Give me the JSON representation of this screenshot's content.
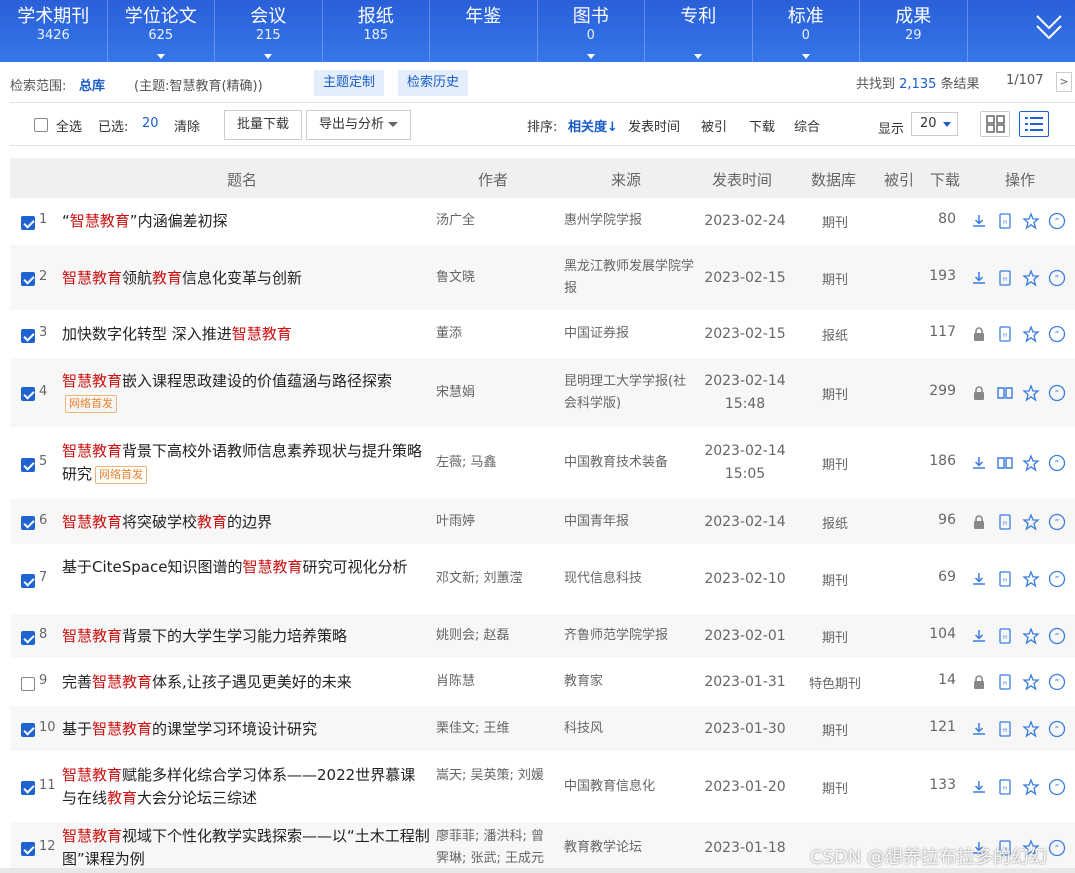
{
  "tabs": [
    {
      "label": "学术期刊",
      "count": "3426",
      "arrow": false
    },
    {
      "label": "学位论文",
      "count": "625",
      "arrow": true
    },
    {
      "label": "会议",
      "count": "215",
      "arrow": true
    },
    {
      "label": "报纸",
      "count": "185",
      "arrow": false
    },
    {
      "label": "年鉴",
      "count": "",
      "arrow": false
    },
    {
      "label": "图书",
      "count": "0",
      "arrow": true
    },
    {
      "label": "专利",
      "count": "",
      "arrow": true
    },
    {
      "label": "标准",
      "count": "0",
      "arrow": true
    },
    {
      "label": "成果",
      "count": "29",
      "arrow": false
    }
  ],
  "scope": {
    "label": "检索范围:",
    "library": "总库",
    "topic": "(主题:智慧教育(精确))",
    "btn_custom": "主题定制",
    "btn_history": "检索历史",
    "found_prefix": "共找到",
    "found_count": "2,135",
    "found_suffix": "条结果",
    "page": "1/107",
    "next": ">"
  },
  "toolbar": {
    "select_all": "全选",
    "selected_label": "已选:",
    "selected_count": "20",
    "clear": "清除",
    "batch_download": "批量下载",
    "export": "导出与分析",
    "sort_label": "排序:",
    "sort_relevance": "相关度",
    "sort_date": "发表时间",
    "sort_cited": "被引",
    "sort_download": "下载",
    "sort_combined": "综合",
    "show_label": "显示",
    "show_value": "20"
  },
  "columns": {
    "title": "题名",
    "author": "作者",
    "source": "来源",
    "date": "发表时间",
    "db": "数据库",
    "cited": "被引",
    "download": "下载",
    "ops": "操作"
  },
  "rows": [
    {
      "no": "1",
      "checked": true,
      "title": [
        "“",
        "智慧教育",
        "”内涵偏差初探"
      ],
      "badge": "",
      "author": "汤广全",
      "source": "惠州学院学报",
      "date": "2023-02-24",
      "time": "",
      "db": "期刊",
      "download": "80",
      "locked": false,
      "read": false
    },
    {
      "no": "2",
      "checked": true,
      "title": [
        "",
        "智慧教育",
        "领航",
        "教育",
        "信息化变革与创新"
      ],
      "badge": "",
      "author": "鲁文晓",
      "source": "黑龙江教师发展学院学报",
      "date": "2023-02-15",
      "time": "",
      "db": "期刊",
      "download": "193",
      "locked": false,
      "read": false
    },
    {
      "no": "3",
      "checked": true,
      "title": [
        "加快数字化转型 深入推进",
        "智慧教育",
        ""
      ],
      "badge": "",
      "author": "董添",
      "source": "中国证券报",
      "date": "2023-02-15",
      "time": "",
      "db": "报纸",
      "download": "117",
      "locked": true,
      "read": false
    },
    {
      "no": "4",
      "checked": true,
      "title": [
        "",
        "智慧教育",
        "嵌入课程思政建设的价值蕴涵与路径探索"
      ],
      "badge": "网络首发",
      "author": "宋慧娟",
      "source": "昆明理工大学学报(社会科学版)",
      "date": "2023-02-14",
      "time": "15:48",
      "db": "期刊",
      "download": "299",
      "locked": true,
      "read": true
    },
    {
      "no": "5",
      "checked": true,
      "title": [
        "",
        "智慧教育",
        "背景下高校外语教师信息素养现状与提升策略研究"
      ],
      "badge": "网络首发",
      "author": "左薇; 马鑫",
      "source": "中国教育技术装备",
      "date": "2023-02-14",
      "time": "15:05",
      "db": "期刊",
      "download": "186",
      "locked": false,
      "read": true
    },
    {
      "no": "6",
      "checked": true,
      "title": [
        "",
        "智慧教育",
        "将突破学校",
        "教育",
        "的边界"
      ],
      "badge": "",
      "author": "叶雨婷",
      "source": "中国青年报",
      "date": "2023-02-14",
      "time": "",
      "db": "报纸",
      "download": "96",
      "locked": true,
      "read": false
    },
    {
      "no": "7",
      "checked": true,
      "title": [
        "基于CiteSpace知识图谱的",
        "智慧教育",
        "研究可视化分析"
      ],
      "badge": "",
      "author": "邓文新; 刘蕙滢",
      "source": "现代信息科技",
      "date": "2023-02-10",
      "time": "",
      "db": "期刊",
      "download": "69",
      "locked": false,
      "read": false
    },
    {
      "no": "8",
      "checked": true,
      "title": [
        "",
        "智慧教育",
        "背景下的大学生学习能力培养策略"
      ],
      "badge": "",
      "author": "姚则会; 赵磊",
      "source": "齐鲁师范学院学报",
      "date": "2023-02-01",
      "time": "",
      "db": "期刊",
      "download": "104",
      "locked": false,
      "read": false
    },
    {
      "no": "9",
      "checked": false,
      "title": [
        "完善",
        "智慧教育",
        "体系,让孩子遇见更美好的未来"
      ],
      "badge": "",
      "author": "肖陈慧",
      "source": "教育家",
      "date": "2023-01-31",
      "time": "",
      "db": "特色期刊",
      "download": "14",
      "locked": true,
      "read": false
    },
    {
      "no": "10",
      "checked": true,
      "title": [
        "基于",
        "智慧教育",
        "的课堂学习环境设计研究"
      ],
      "badge": "",
      "author": "栗佳文; 王维",
      "source": "科技风",
      "date": "2023-01-30",
      "time": "",
      "db": "期刊",
      "download": "121",
      "locked": false,
      "read": false
    },
    {
      "no": "11",
      "checked": true,
      "title": [
        "",
        "智慧教育",
        "赋能多样化综合学习体系——2022世界慕课与在线",
        "教育",
        "大会分论坛三综述"
      ],
      "badge": "",
      "author": "嵩天; 吴英策; 刘媛",
      "source": "中国教育信息化",
      "date": "2023-01-20",
      "time": "",
      "db": "期刊",
      "download": "133",
      "locked": false,
      "read": false
    },
    {
      "no": "12",
      "checked": true,
      "title": [
        "",
        "智慧教育",
        "视域下个性化教学实践探索——以“土木工程制图”课程为例"
      ],
      "badge": "",
      "author": "廖菲菲; 潘洪科; 曾霁琳; 张武; 王成元",
      "source": "教育教学论坛",
      "date": "2023-01-18",
      "time": "",
      "db": "",
      "download": "",
      "locked": false,
      "read": false
    }
  ],
  "watermark": "CSDN @想养拉布拉多的幻幻",
  "colors": {
    "accent": "#1a5dc8",
    "highlight": "#cc1111",
    "topbar": "#2f6be3",
    "badge": "#e8812a"
  }
}
